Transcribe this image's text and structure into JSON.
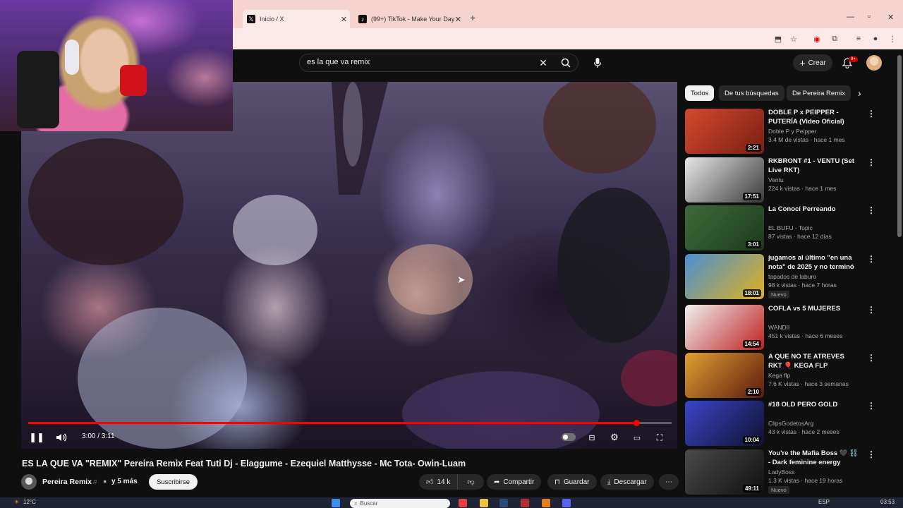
{
  "browser": {
    "tabs": [
      {
        "label": "Inicio / X",
        "icon": "x-logo-icon"
      },
      {
        "label": "(99+) TikTok - Make Your Day",
        "icon": "tiktok-icon"
      }
    ],
    "new_tab": "+"
  },
  "youtube": {
    "search": {
      "value": "es la que va remix"
    },
    "create_label": "Crear",
    "notif_count": "9+"
  },
  "video": {
    "time": "3:00 / 3:11",
    "progress": 0.945,
    "title": "ES LA QUE VA \"REMIX\" Pereira Remix Feat Tuti Dj - Elaggume - Ezequiel Matthysse - Mc Tota- Owin-Luam",
    "channel": "Pereira Remix",
    "channel_extra": "y 5 más",
    "subscribe": "Suscribirse",
    "likes": "14 k",
    "share": "Compartir",
    "save": "Guardar",
    "download": "Descargar"
  },
  "chips": [
    "Todos",
    "De tus búsquedas",
    "De Pereira Remix"
  ],
  "recommendations": [
    {
      "title": "DOBLE P x PEIPPER - PUTERÍA (Video Oficial)",
      "channel": "Doble P y Peipper",
      "meta": "3.4 M de vistas · hace 1 mes",
      "duration": "2:21",
      "colors": [
        "#d24a2f",
        "#7a1e12"
      ],
      "new": ""
    },
    {
      "title": "RKBRONT #1 - VENTU (Set Live RKT)",
      "channel": "Ventu",
      "meta": "224 k vistas · hace 1 mes",
      "duration": "17:51",
      "colors": [
        "#e8e8e8",
        "#3a3a3a"
      ],
      "new": ""
    },
    {
      "title": "La Conocí Perreando",
      "channel": "EL BUFU - Topic",
      "meta": "87 vistas · hace 12 días",
      "duration": "3:01",
      "colors": [
        "#3e6b3a",
        "#1d3a1c"
      ],
      "new": ""
    },
    {
      "title": "jugamos al último \"en una nota\" de 2025 y no terminó como ...",
      "channel": "tapados de laburo",
      "meta": "98 k vistas · hace 7 horas",
      "duration": "18:01",
      "colors": [
        "#4a8fd0",
        "#e0b020"
      ],
      "new": "Nuevo"
    },
    {
      "title": "COFLA vs 5 MUJERES",
      "channel": "WANDII",
      "meta": "451 k vistas · hace 6 meses",
      "duration": "14:54",
      "colors": [
        "#f0f0f0",
        "#c02020"
      ],
      "new": ""
    },
    {
      "title": "A QUE NO TE ATREVES RKT 🎈 KEGA FLP",
      "channel": "Kega flp",
      "meta": "7.6 K vistas · hace 3 semanas",
      "duration": "2:10",
      "colors": [
        "#e0a030",
        "#5a1a10"
      ],
      "new": ""
    },
    {
      "title": "#18 OLD PERO GOLD",
      "channel": "ClipsGodetosArg",
      "meta": "43 k vistas · hace 2 meses",
      "duration": "10:04",
      "colors": [
        "#3a46c8",
        "#101030"
      ],
      "new": ""
    },
    {
      "title": "You're the Mafia Boss 🖤 ⛓️ - Dark feminine energy playlist| ...",
      "channel": "LadyBoss",
      "meta": "1.3 K vistas · hace 19 horas",
      "duration": "49:11",
      "colors": [
        "#4a4a4a",
        "#101010"
      ],
      "new": "Nuevo"
    }
  ],
  "taskbar": {
    "temp": "12°C",
    "search_placeholder": "Buscar",
    "lang": "ESP",
    "clock": "03:53"
  },
  "colors": {
    "accent": "#ff0000",
    "bg": "#0f0f0f",
    "tab_bg": "#f5d3cf"
  }
}
